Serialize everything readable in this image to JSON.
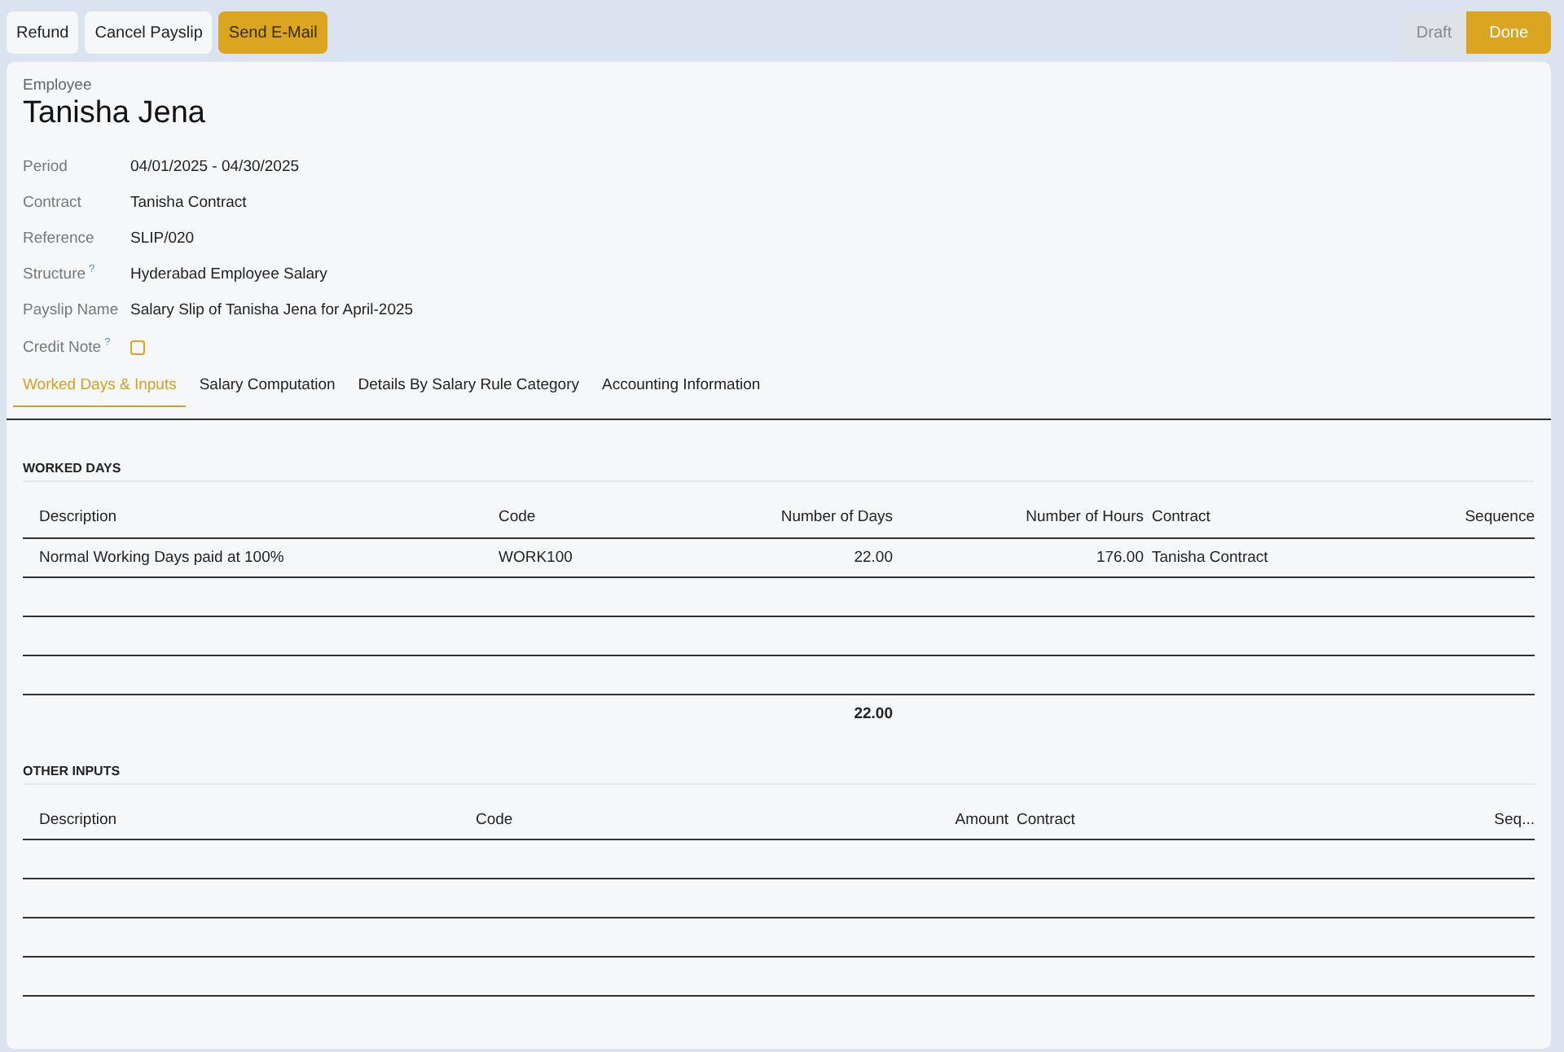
{
  "actions": [
    {
      "label": "Refund",
      "kind": "plain"
    },
    {
      "label": "Cancel Payslip",
      "kind": "plain"
    },
    {
      "label": "Send E-Mail",
      "kind": "primary"
    }
  ],
  "status_bar": [
    {
      "label": "Draft",
      "selected": false
    },
    {
      "label": "Done",
      "selected": true
    }
  ],
  "employee": {
    "label": "Employee",
    "name": "Tanisha Jena"
  },
  "fields": [
    {
      "label": "Period",
      "kind": "text",
      "value": "04/01/2025 - 04/30/2025"
    },
    {
      "label": "Contract",
      "kind": "text",
      "value": "Tanisha Contract"
    },
    {
      "label": "Reference",
      "kind": "text",
      "value": "SLIP/020"
    },
    {
      "label": "Structure",
      "help": "?",
      "kind": "text",
      "value": "Hyderabad Employee Salary"
    },
    {
      "label": "Payslip Name",
      "kind": "text",
      "value": "Salary Slip of Tanisha Jena for April-2025"
    },
    {
      "label": "Credit Note",
      "help": "?",
      "kind": "checkbox",
      "checked": false
    }
  ],
  "tabs": [
    {
      "label": "Worked Days & Inputs",
      "selected": true
    },
    {
      "label": "Salary Computation",
      "selected": false
    },
    {
      "label": "Details By Salary Rule Category",
      "selected": false
    },
    {
      "label": "Accounting Information",
      "selected": false
    }
  ],
  "worked_days": {
    "title": "WORKED DAYS",
    "columns": [
      "Description",
      "Code",
      "Number of Days",
      "Number of Hours",
      "Contract",
      "Sequence"
    ],
    "rows": [
      [
        "Normal Working Days paid at 100%",
        "WORK100",
        "22.00",
        "176.00",
        "Tanisha Contract"
      ]
    ],
    "total_days": "22.00"
  },
  "other_inputs": {
    "title": "OTHER INPUTS",
    "columns": [
      "Description",
      "Code",
      "Amount",
      "Contract",
      "Seq..."
    ]
  }
}
